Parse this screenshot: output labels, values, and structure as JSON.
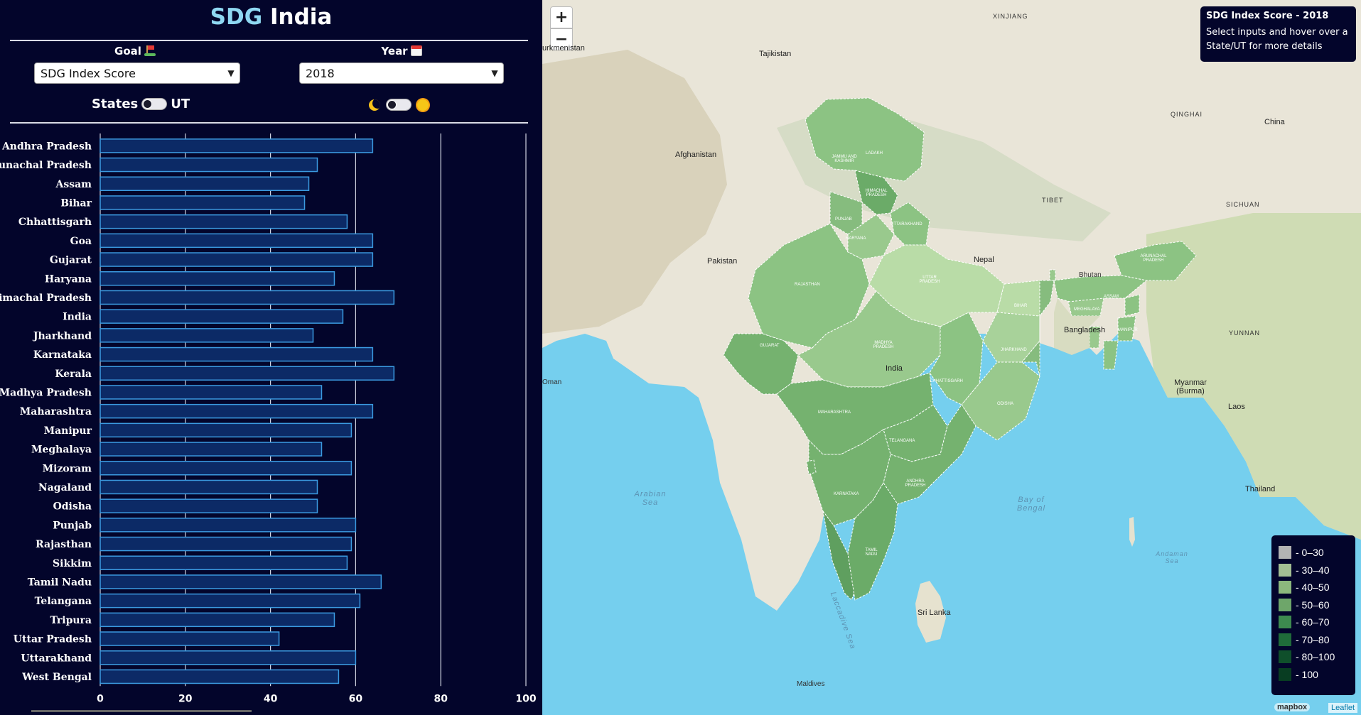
{
  "header": {
    "title_accent": "SDG",
    "title_rest": " India"
  },
  "controls": {
    "goal_label": "Goal",
    "goal_icon": "golf-flag-icon",
    "goal_value": "SDG Index Score",
    "year_label": "Year",
    "year_icon": "calendar-icon",
    "year_value": "2018",
    "states_label": "States",
    "ut_label": "UT",
    "theme_dark_icon": "moon-icon",
    "theme_light_icon": "sun-icon"
  },
  "chart_data": {
    "type": "bar",
    "orientation": "horizontal",
    "categories": [
      "Andhra Pradesh",
      "Arunachal Pradesh",
      "Assam",
      "Bihar",
      "Chhattisgarh",
      "Goa",
      "Gujarat",
      "Haryana",
      "Himachal Pradesh",
      "India",
      "Jharkhand",
      "Karnataka",
      "Kerala",
      "Madhya Pradesh",
      "Maharashtra",
      "Manipur",
      "Meghalaya",
      "Mizoram",
      "Nagaland",
      "Odisha",
      "Punjab",
      "Rajasthan",
      "Sikkim",
      "Tamil Nadu",
      "Telangana",
      "Tripura",
      "Uttar Pradesh",
      "Uttarakhand",
      "West Bengal"
    ],
    "values": [
      64,
      51,
      49,
      48,
      58,
      64,
      64,
      55,
      69,
      57,
      50,
      64,
      69,
      52,
      64,
      59,
      52,
      59,
      51,
      51,
      60,
      59,
      58,
      66,
      61,
      55,
      42,
      60,
      56
    ],
    "xlim": [
      0,
      100
    ],
    "xticks": [
      "0",
      "20",
      "40",
      "60",
      "80",
      "100"
    ],
    "grid": true,
    "bar_color": "#0c2a66",
    "bar_edge_color": "#3b9ae0"
  },
  "map": {
    "zoom_in": "+",
    "zoom_out": "−",
    "info_title": "SDG Index Score - 2018",
    "info_text": "Select inputs and hover over a State/UT for more details",
    "legend": [
      {
        "label": "- 0–30",
        "color": "#b3b3b3"
      },
      {
        "label": "- 30–40",
        "color": "#a3bf93"
      },
      {
        "label": "- 40–50",
        "color": "#8cb87d"
      },
      {
        "label": "- 50–60",
        "color": "#6ea66a"
      },
      {
        "label": "- 60–70",
        "color": "#3d8a4f"
      },
      {
        "label": "- 70–80",
        "color": "#1f6b3a"
      },
      {
        "label": "- 80–100",
        "color": "#0f4f2b"
      },
      {
        "label": "- 100",
        "color": "#083d22"
      }
    ],
    "places": {
      "tajikistan": "Tajikistan",
      "turkmenistan": "urkmenistan",
      "afghanistan": "Afghanistan",
      "pakistan": "Pakistan",
      "nepal": "Nepal",
      "bhutan": "Bhutan",
      "bangladesh": "Bangladesh",
      "india": "India",
      "myanmar": "Myanmar (Burma)",
      "china": "China",
      "laos": "Laos",
      "thailand": "Thailand",
      "srilanka": "Sri Lanka",
      "maldives": "Maldives",
      "xinjiang": "XINJIANG",
      "tibet": "TIBET",
      "qinghai": "QINGHAI",
      "sichuan": "SICHUAN",
      "yunnan": "YUNNAN",
      "oman": "Oman"
    },
    "seas": {
      "arabian": "Arabian Sea",
      "bengal": "Bay of Bengal",
      "laccadive": "Laccadive Sea",
      "andaman": "Andaman Sea"
    },
    "state_labels": {
      "jk": "JAMMU AND KASHMIR",
      "hp": "HIMACHAL PRADESH",
      "ladakh": "LADAKH",
      "punjab": "PUNJAB",
      "uk": "UTTARAKHAND",
      "haryana": "HARYANA",
      "rajasthan": "RAJASTHAN",
      "up": "UTTAR PRADESH",
      "bihar": "BIHAR",
      "gujarat": "GUJARAT",
      "mp": "MADHYA PRADESH",
      "jharkhand": "JHARKHAND",
      "chh": "CHHATTISGARH",
      "odisha": "ODISHA",
      "mh": "MAHARASHTRA",
      "tg": "TELANGANA",
      "ap": "ANDHRA PRADESH",
      "ka": "KARNATAKA",
      "tn": "TAMIL NADU",
      "ar": "ARUNACHAL PRADESH",
      "assam": "ASSAM",
      "meghalaya": "MEGHALAYA",
      "manipur": "MANIPUR"
    },
    "attribution_logo": "mapbox",
    "attribution_leaflet": "Leaflet"
  }
}
